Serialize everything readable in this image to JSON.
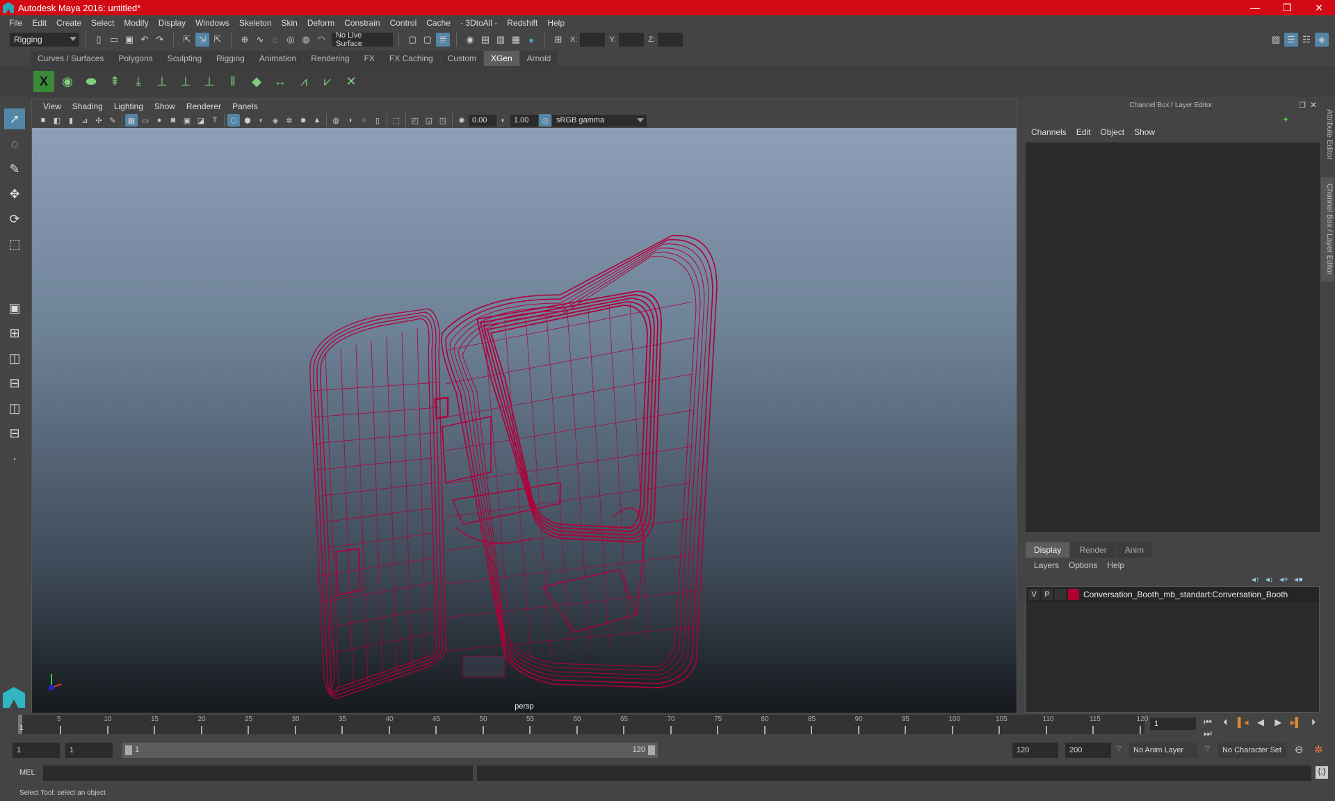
{
  "window": {
    "title": "Autodesk Maya 2016: untitled*",
    "controls": [
      "—",
      "❐",
      "✕"
    ]
  },
  "menubar": [
    "File",
    "Edit",
    "Create",
    "Select",
    "Modify",
    "Display",
    "Windows",
    "Skeleton",
    "Skin",
    "Deform",
    "Constrain",
    "Control",
    "Cache",
    "- 3DtoAll -",
    "Redshift",
    "Help"
  ],
  "statusline": {
    "menuset": "Rigging",
    "live_surface": "No Live Surface",
    "x_label": "X:",
    "y_label": "Y:",
    "z_label": "Z:"
  },
  "shelf_tabs": [
    "Curves / Surfaces",
    "Polygons",
    "Sculpting",
    "Rigging",
    "Animation",
    "Rendering",
    "FX",
    "FX Caching",
    "Custom",
    "XGen",
    "Arnold"
  ],
  "active_shelf": "XGen",
  "viewport": {
    "menus": [
      "View",
      "Shading",
      "Lighting",
      "Show",
      "Renderer",
      "Panels"
    ],
    "exposure": "0.00",
    "gamma": "1.00",
    "color_space": "sRGB gamma",
    "camera_label": "persp",
    "wire_color": "#b0003a"
  },
  "channel_box": {
    "title": "Channel Box / Layer Editor",
    "menus": [
      "Channels",
      "Edit",
      "Object",
      "Show"
    ]
  },
  "layer_editor": {
    "tabs": [
      "Display",
      "Render",
      "Anim"
    ],
    "active_tab": "Display",
    "menus": [
      "Layers",
      "Options",
      "Help"
    ],
    "layers": [
      {
        "v": "V",
        "p": "P",
        "color": "#b00030",
        "name": "Conversation_Booth_mb_standart:Conversation_Booth"
      }
    ]
  },
  "side_tabs": [
    "Attribute Editor",
    "Channel Box / Layer Editor"
  ],
  "timeline": {
    "ticks": [
      5,
      10,
      15,
      20,
      25,
      30,
      35,
      40,
      45,
      50,
      55,
      60,
      65,
      70,
      75,
      80,
      85,
      90,
      95,
      100,
      105,
      110,
      115,
      120
    ],
    "current_frame": "1",
    "current_frame_field": "1"
  },
  "range": {
    "start": "1",
    "playback_start": "1",
    "slider_start": "1",
    "slider_end": "120",
    "playback_end": "120",
    "end": "200",
    "anim_layer": "No Anim Layer",
    "character_set": "No Character Set"
  },
  "command": {
    "label": "MEL"
  },
  "help_line": "Select Tool: select an object"
}
